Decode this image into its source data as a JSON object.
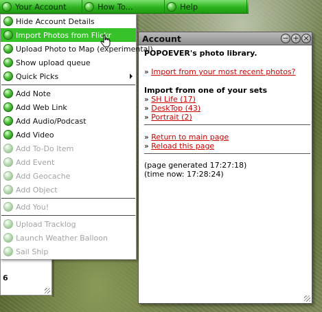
{
  "menubar": {
    "items": [
      {
        "label": "Your Account"
      },
      {
        "label": "How To..."
      },
      {
        "label": "Help"
      }
    ]
  },
  "dropdown": {
    "items": [
      {
        "label": "Hide Account Details",
        "disabled": false
      },
      {
        "label": "Import Photos from Flickr",
        "disabled": false,
        "highlighted": true
      },
      {
        "label": "Upload Photo to Map (experimental)",
        "disabled": false
      },
      {
        "label": "Show upload queue",
        "disabled": false
      },
      {
        "label": "Quick Picks",
        "disabled": false,
        "submenu": true
      },
      {
        "label": "Add Note",
        "disabled": false
      },
      {
        "label": "Add Web Link",
        "disabled": false
      },
      {
        "label": "Add Audio/Podcast",
        "disabled": false
      },
      {
        "label": "Add Video",
        "disabled": false
      },
      {
        "label": "Add To-Do Item",
        "disabled": true
      },
      {
        "label": "Add Event",
        "disabled": true
      },
      {
        "label": "Add Geocache",
        "disabled": true
      },
      {
        "label": "Add Object",
        "disabled": true
      },
      {
        "label": "Add You!",
        "disabled": true
      },
      {
        "label": "Upload Tracklog",
        "disabled": true
      },
      {
        "label": "Launch Weather Balloon",
        "disabled": true
      },
      {
        "label": "Sail Ship",
        "disabled": true
      }
    ]
  },
  "left_window": {
    "value": "6"
  },
  "account": {
    "title": "Account",
    "buttons": {
      "minimize": "−",
      "maximize": "+",
      "close": "×"
    },
    "library_heading": "POPOEVER's photo library.",
    "recent_prefix": "»",
    "recent_link": "Import from your most recent photos?",
    "sets_heading": "Import from one of your sets",
    "sets": [
      {
        "prefix": "»",
        "label": "SH Life (17)"
      },
      {
        "prefix": "»",
        "label": "DeskTop (43)"
      },
      {
        "prefix": "»",
        "label": "Portrait (2)"
      }
    ],
    "nav": [
      {
        "prefix": "»",
        "label": "Return to main page"
      },
      {
        "prefix": "»",
        "label": "Reload this page"
      }
    ],
    "generated": "(page generated 17:27:18)",
    "now": "(time now: 17:28:24)"
  }
}
